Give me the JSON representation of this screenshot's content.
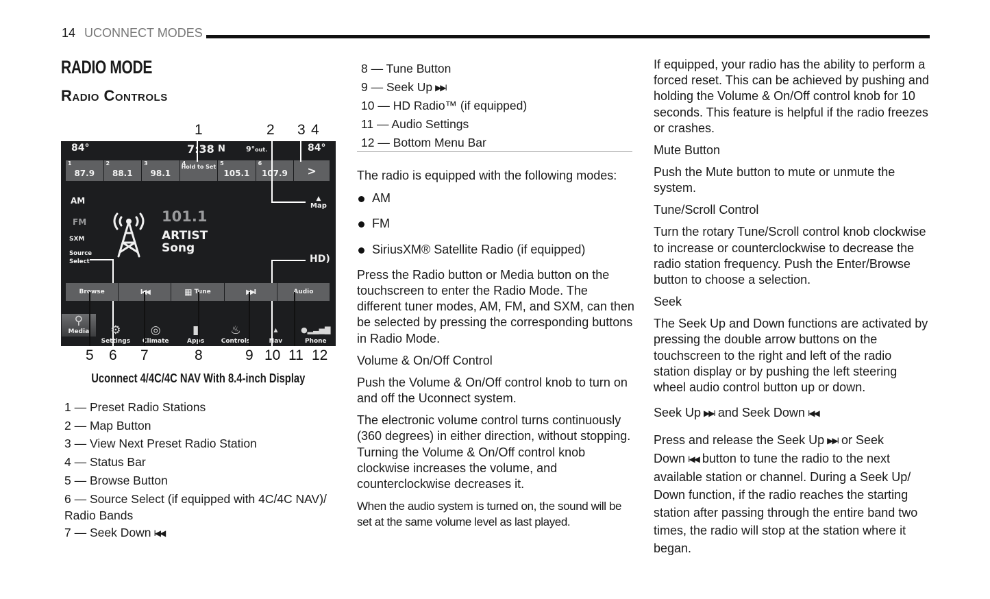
{
  "header": {
    "page_number": "14",
    "section": "UCONNECT MODES"
  },
  "title": "RADIO MODE",
  "subtitle": "Radio Controls",
  "figure": {
    "callouts_top": [
      "1",
      "2",
      "3",
      "4"
    ],
    "callouts_bottom": [
      "5",
      "6",
      "7",
      "8",
      "9",
      "10",
      "11",
      "12"
    ],
    "status_bar": {
      "temp_left": "84°",
      "time": "7:38",
      "compass": "N",
      "outside_temp": "9°",
      "outside_label": "out.",
      "temp_right": "84°"
    },
    "presets": [
      {
        "num": "1",
        "value": "87.9"
      },
      {
        "num": "2",
        "value": "88.1"
      },
      {
        "num": "3",
        "value": "98.1"
      },
      {
        "num": "4",
        "value": "Hold to Set"
      },
      {
        "num": "5",
        "value": "105.1"
      },
      {
        "num": "6",
        "value": "107.9"
      }
    ],
    "next_preset_label": ">",
    "bands": [
      "AM",
      "FM",
      "SXM"
    ],
    "source_select": "Source Select",
    "station": {
      "frequency": "101.1",
      "artist": "ARTIST",
      "song": "Song"
    },
    "map_label": "Map",
    "hd_label": "HD)",
    "controls": {
      "browse": "Browse",
      "seek_down": "I◀◀",
      "tune": "Tune",
      "seek_up": "▶▶I",
      "audio": "Audio"
    },
    "menu": [
      {
        "label": "Media",
        "icon": "usb-icon"
      },
      {
        "label": "Settings",
        "icon": "gear-icon"
      },
      {
        "label": "Climate",
        "icon": "climate-icon"
      },
      {
        "label": "Apps",
        "icon": "apps-icon"
      },
      {
        "label": "Controls",
        "icon": "seat-icon"
      },
      {
        "label": "Nav",
        "icon": "nav-icon"
      },
      {
        "label": "Phone",
        "icon": "phone-signal-icon"
      }
    ],
    "caption": "Uconnect 4/4C/4C NAV With 8.4-inch Display"
  },
  "legend": [
    "1 — Preset Radio Stations",
    "2 — Map Button",
    "3 — View Next Preset Radio Station",
    "4 — Status Bar",
    "5 — Browse Button",
    "6 — Source Select (if equipped with 4C/4C NAV)/ Radio Bands",
    "7 — Seek Down",
    "8 — Tune Button",
    "9 — Seek Up",
    "10 — HD Radio™ (if equipped)",
    "11 — Audio Settings",
    "12 — Bottom Menu Bar"
  ],
  "glyphs": {
    "seek_down": "I◀◀",
    "seek_up": "▶▶I"
  },
  "col2": {
    "intro": "The radio is equipped with the following modes:",
    "modes": [
      "AM",
      "FM",
      "SiriusXM® Satellite Radio (if equipped)"
    ],
    "para1": "Press the Radio button or Media button on the touchscreen to enter the Radio Mode. The different tuner modes, AM, FM, and SXM, can then be selected by pressing the corresponding buttons in Radio Mode.",
    "volume_heading": "Volume & On/Off Control",
    "volume_p1": "Push the Volume & On/Off control knob to turn on and off the Uconnect system.",
    "volume_p2": "The electronic volume control turns continuously (360 degrees) in either direction, without stopping. Turning the Volume & On/Off control knob clockwise increases the volume, and counterclockwise decreases it.",
    "volume_p3": "When the audio system is turned on, the sound will be set at the same volume level as last played."
  },
  "col3": {
    "reset_p": "If equipped, your radio has the ability to perform a forced reset. This can be achieved by pushing and holding the Volume & On/Off control knob for 10 seconds. This feature is helpful if the radio freezes or crashes.",
    "mute_heading": "Mute Button",
    "mute_p": "Push the Mute button to mute or unmute the system.",
    "tune_heading": "Tune/Scroll Control",
    "tune_p": "Turn the rotary Tune/Scroll control knob clockwise to increase or counterclockwise to decrease the radio station frequency. Push the Enter/Browse button to choose a selection.",
    "seek_heading": "Seek",
    "seek_p": "The Seek Up and Down functions are activated by pressing the double arrow buttons on the touchscreen to the right and left of the radio station display or by pushing the left steering wheel audio control button up or down.",
    "seekupdown_heading_a": "Seek Up",
    "seekupdown_heading_b": "and Seek Down",
    "seekupdown_p_a": "Press and release the Seek Up",
    "seekupdown_p_b": "or Seek Down",
    "seekupdown_p_c": "button to tune the radio to the next available station or channel. During a Seek Up/ Down function, if the radio reaches the starting station after passing through the entire band two times, the radio will stop at the station where it began."
  }
}
